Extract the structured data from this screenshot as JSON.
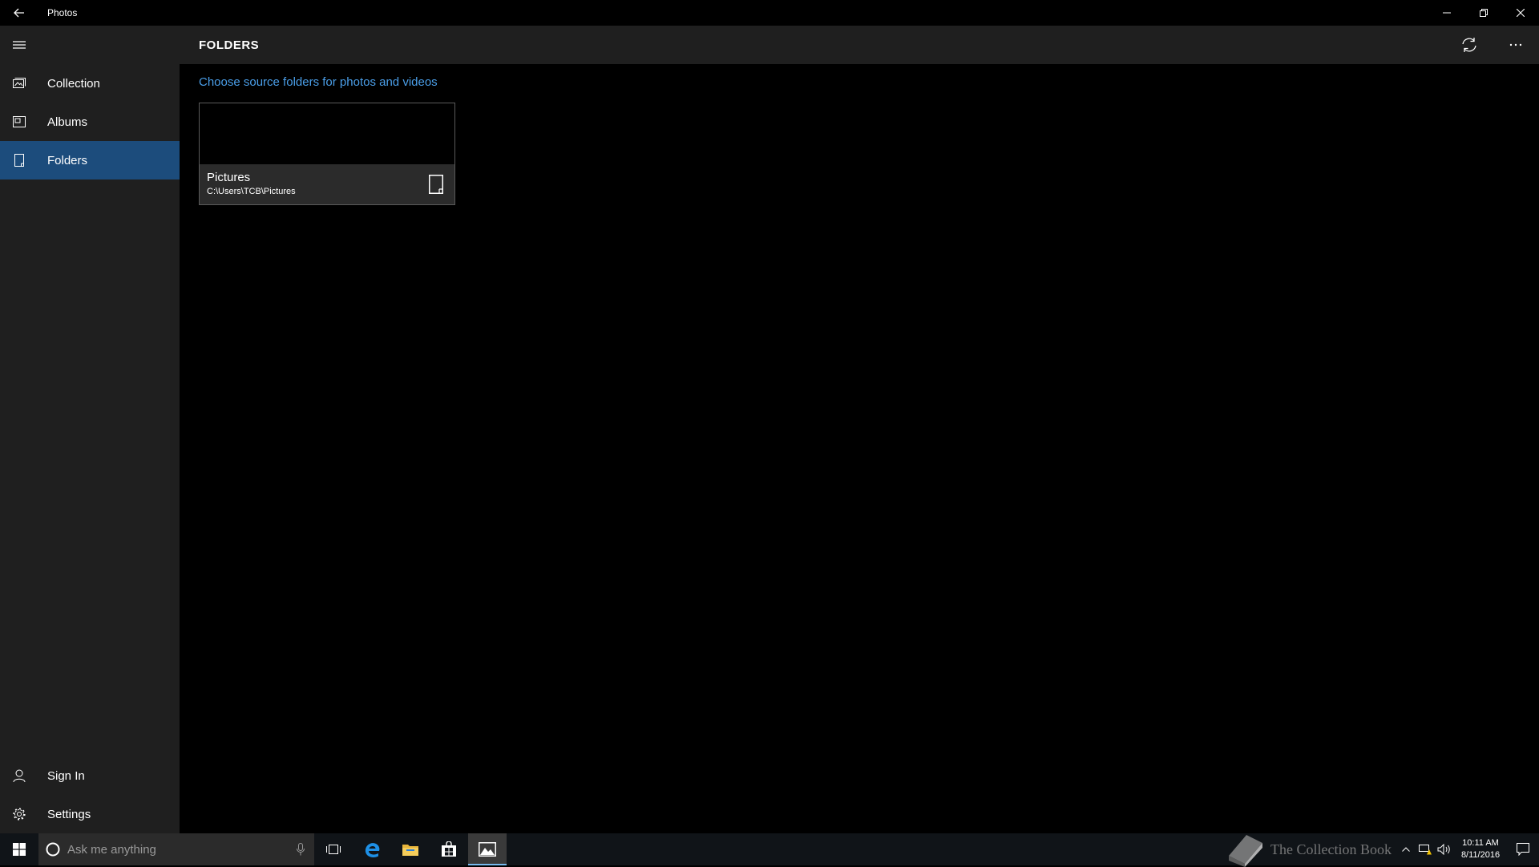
{
  "window": {
    "title": "Photos"
  },
  "sidebar": {
    "items": [
      {
        "label": "Collection",
        "icon": "collection-icon"
      },
      {
        "label": "Albums",
        "icon": "albums-icon"
      },
      {
        "label": "Folders",
        "icon": "folders-icon",
        "active": true
      }
    ],
    "bottom_items": [
      {
        "label": "Sign In",
        "icon": "person-icon"
      },
      {
        "label": "Settings",
        "icon": "gear-icon"
      }
    ]
  },
  "header": {
    "title": "FOLDERS"
  },
  "main": {
    "source_link": "Choose source folders for photos and videos",
    "folders": [
      {
        "name": "Pictures",
        "path": "C:\\Users\\TCB\\Pictures"
      }
    ]
  },
  "taskbar": {
    "search_placeholder": "Ask me anything",
    "clock_time": "10:11 AM",
    "clock_date": "8/11/2016",
    "watermark": "The Collection Book"
  },
  "colors": {
    "accent": "#1c4c7c",
    "link": "#4a9ee8",
    "sidebar_bg": "#1f1f1f",
    "background": "#000000"
  }
}
